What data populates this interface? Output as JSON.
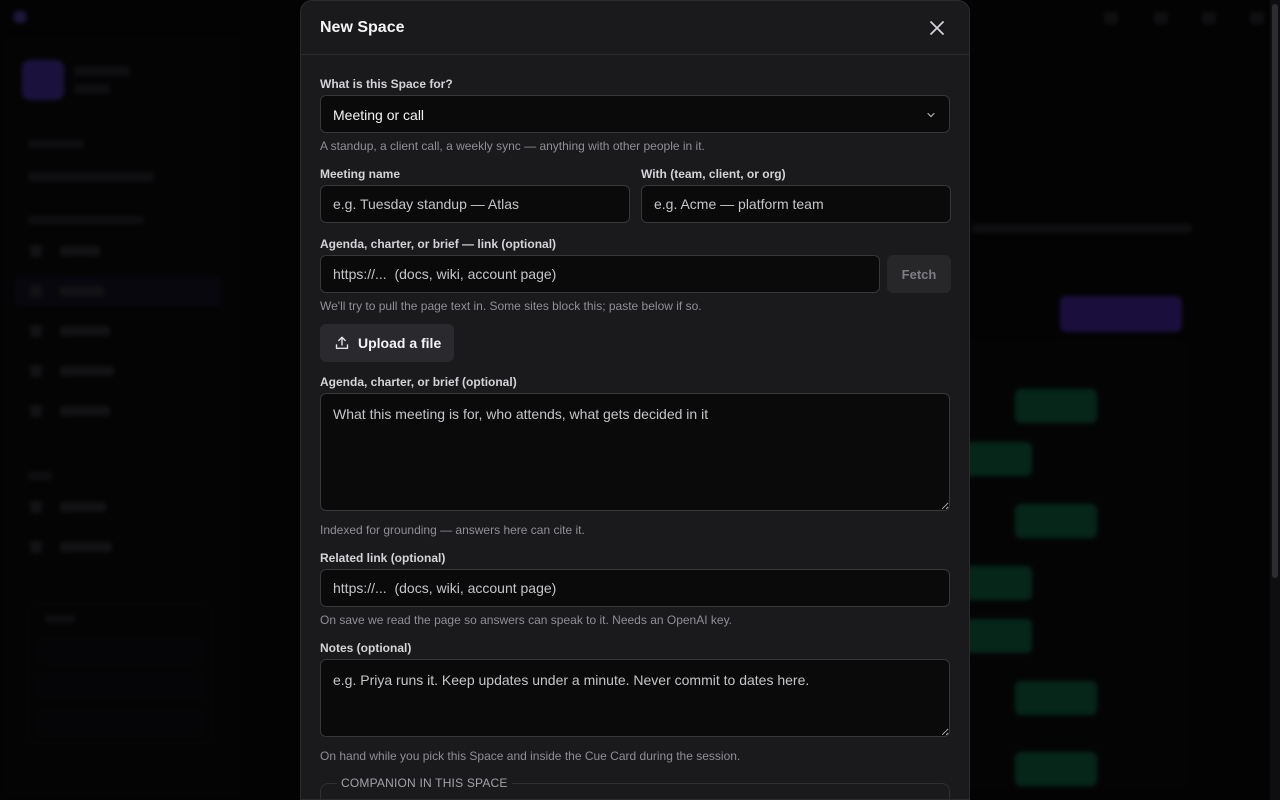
{
  "modal": {
    "title": "New Space",
    "purpose": {
      "label": "What is this Space for?",
      "selected": "Meeting or call",
      "hint": "A standup, a client call, a weekly sync — anything with other people in it."
    },
    "meeting_name": {
      "label": "Meeting name",
      "placeholder": "e.g. Tuesday standup — Atlas"
    },
    "with_field": {
      "label": "With (team, client, or org)",
      "placeholder": "e.g. Acme — platform team"
    },
    "agenda_link": {
      "label": "Agenda, charter, or brief — link (optional)",
      "placeholder": "https://...  (docs, wiki, account page)",
      "fetch_label": "Fetch",
      "hint": "We'll try to pull the page text in. Some sites block this; paste below if so."
    },
    "upload": {
      "label": "Upload a file"
    },
    "agenda_text": {
      "label": "Agenda, charter, or brief (optional)",
      "placeholder": "What this meeting is for, who attends, what gets decided in it",
      "hint": "Indexed for grounding — answers here can cite it."
    },
    "related_link": {
      "label": "Related link (optional)",
      "placeholder": "https://...  (docs, wiki, account page)",
      "hint": "On save we read the page so answers can speak to it. Needs an OpenAI key."
    },
    "notes": {
      "label": "Notes (optional)",
      "placeholder": "e.g. Priya runs it. Keep updates under a minute. Never commit to dates here.",
      "hint": "On hand while you pick this Space and inside the Cue Card during the session."
    },
    "companion_section": {
      "legend": "COMPANION IN THIS SPACE"
    }
  },
  "icons": {
    "close": "close-icon",
    "chevron": "chevron-down-icon",
    "upload": "upload-icon"
  },
  "colors": {
    "modal_bg": "#1a1a1c",
    "input_bg": "#0a0a0b",
    "accent_purple": "#6d3cff",
    "start_green": "#0f9f66"
  }
}
